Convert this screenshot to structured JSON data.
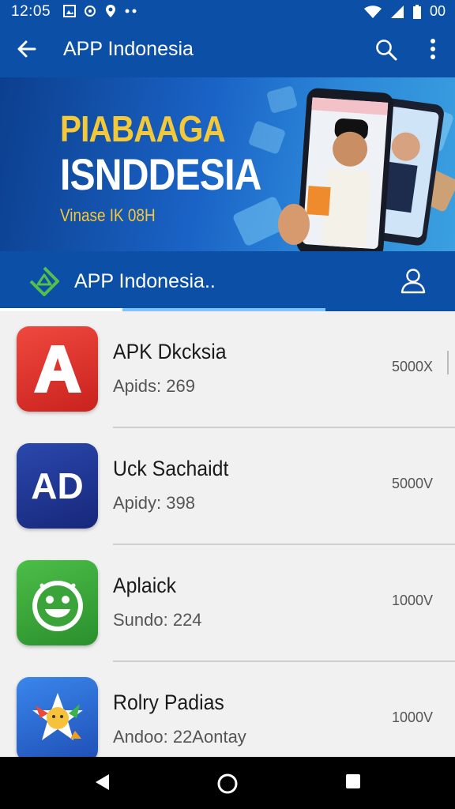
{
  "status_bar": {
    "time": "12:05",
    "right_text": "00",
    "icons": [
      "gallery-icon",
      "sync-icon",
      "location-icon",
      "more-dots-icon",
      "wifi-icon",
      "signal-icon",
      "battery-icon"
    ]
  },
  "app_bar": {
    "title": "APP Indonesia",
    "icons": [
      "back-arrow-icon",
      "search-icon",
      "more-vert-icon"
    ]
  },
  "banner": {
    "line1": "PIABAAGA",
    "line2": "ISNDDESIA",
    "line3": "Vinase IK 08H"
  },
  "tab_bar": {
    "label": "APP Indonesia..",
    "icons": [
      "app-logo-icon",
      "person-icon"
    ]
  },
  "apps": [
    {
      "name": "APK Dkcksia",
      "subtitle": "Apids: 269",
      "count": "5000X",
      "icon": "letter-a-icon",
      "icon_text": "A",
      "icon_color": "#e0312c"
    },
    {
      "name": "Uck Sachaidt",
      "subtitle": "Apidy: 398",
      "count": "5000V",
      "icon": "ad-text-icon",
      "icon_text": "AD",
      "icon_color": "#1f3694"
    },
    {
      "name": "Aplaick",
      "subtitle": "Sundo: 224",
      "count": "1000V",
      "icon": "smiley-robot-icon",
      "icon_text": "",
      "icon_color": "#3aa43a"
    },
    {
      "name": "Rolry Padias",
      "subtitle": "Andoo: 22Aontay",
      "count": "1000V",
      "icon": "colorful-star-icon",
      "icon_text": "",
      "icon_color": "#2a68d4"
    }
  ],
  "nav_bar": {
    "icons": [
      "back-triangle-icon",
      "home-circle-icon",
      "recents-square-icon"
    ]
  }
}
